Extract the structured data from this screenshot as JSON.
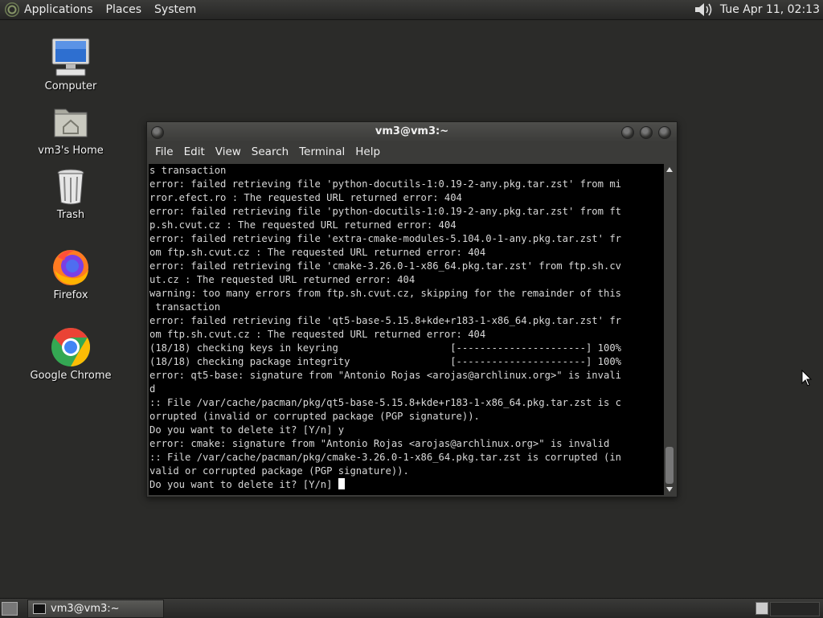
{
  "top_panel": {
    "menus": [
      "Applications",
      "Places",
      "System"
    ],
    "clock": "Tue Apr 11, 02:13"
  },
  "desktop_icons": [
    {
      "label": "Computer",
      "icon": "computer-icon"
    },
    {
      "label": "vm3's Home",
      "icon": "home-folder-icon"
    },
    {
      "label": "Trash",
      "icon": "trash-icon"
    },
    {
      "label": "Firefox",
      "icon": "firefox-icon"
    },
    {
      "label": "Google Chrome",
      "icon": "chrome-icon"
    }
  ],
  "terminal": {
    "title": "vm3@vm3:~",
    "menu": [
      "File",
      "Edit",
      "View",
      "Search",
      "Terminal",
      "Help"
    ],
    "lines": [
      "s transaction",
      "error: failed retrieving file 'python-docutils-1:0.19-2-any.pkg.tar.zst' from mi",
      "rror.efect.ro : The requested URL returned error: 404",
      "error: failed retrieving file 'python-docutils-1:0.19-2-any.pkg.tar.zst' from ft",
      "p.sh.cvut.cz : The requested URL returned error: 404",
      "error: failed retrieving file 'extra-cmake-modules-5.104.0-1-any.pkg.tar.zst' fr",
      "om ftp.sh.cvut.cz : The requested URL returned error: 404",
      "error: failed retrieving file 'cmake-3.26.0-1-x86_64.pkg.tar.zst' from ftp.sh.cv",
      "ut.cz : The requested URL returned error: 404",
      "warning: too many errors from ftp.sh.cvut.cz, skipping for the remainder of this",
      " transaction",
      "error: failed retrieving file 'qt5-base-5.15.8+kde+r183-1-x86_64.pkg.tar.zst' fr",
      "om ftp.sh.cvut.cz : The requested URL returned error: 404",
      "(18/18) checking keys in keyring                   [----------------------] 100%",
      "(18/18) checking package integrity                 [----------------------] 100%",
      "error: qt5-base: signature from \"Antonio Rojas <arojas@archlinux.org>\" is invali",
      "d",
      ":: File /var/cache/pacman/pkg/qt5-base-5.15.8+kde+r183-1-x86_64.pkg.tar.zst is c",
      "orrupted (invalid or corrupted package (PGP signature)).",
      "Do you want to delete it? [Y/n] y",
      "error: cmake: signature from \"Antonio Rojas <arojas@archlinux.org>\" is invalid",
      ":: File /var/cache/pacman/pkg/cmake-3.26.0-1-x86_64.pkg.tar.zst is corrupted (in",
      "valid or corrupted package (PGP signature)).",
      "Do you want to delete it? [Y/n] "
    ]
  },
  "taskbar": {
    "tasks": [
      "vm3@vm3:~"
    ]
  }
}
